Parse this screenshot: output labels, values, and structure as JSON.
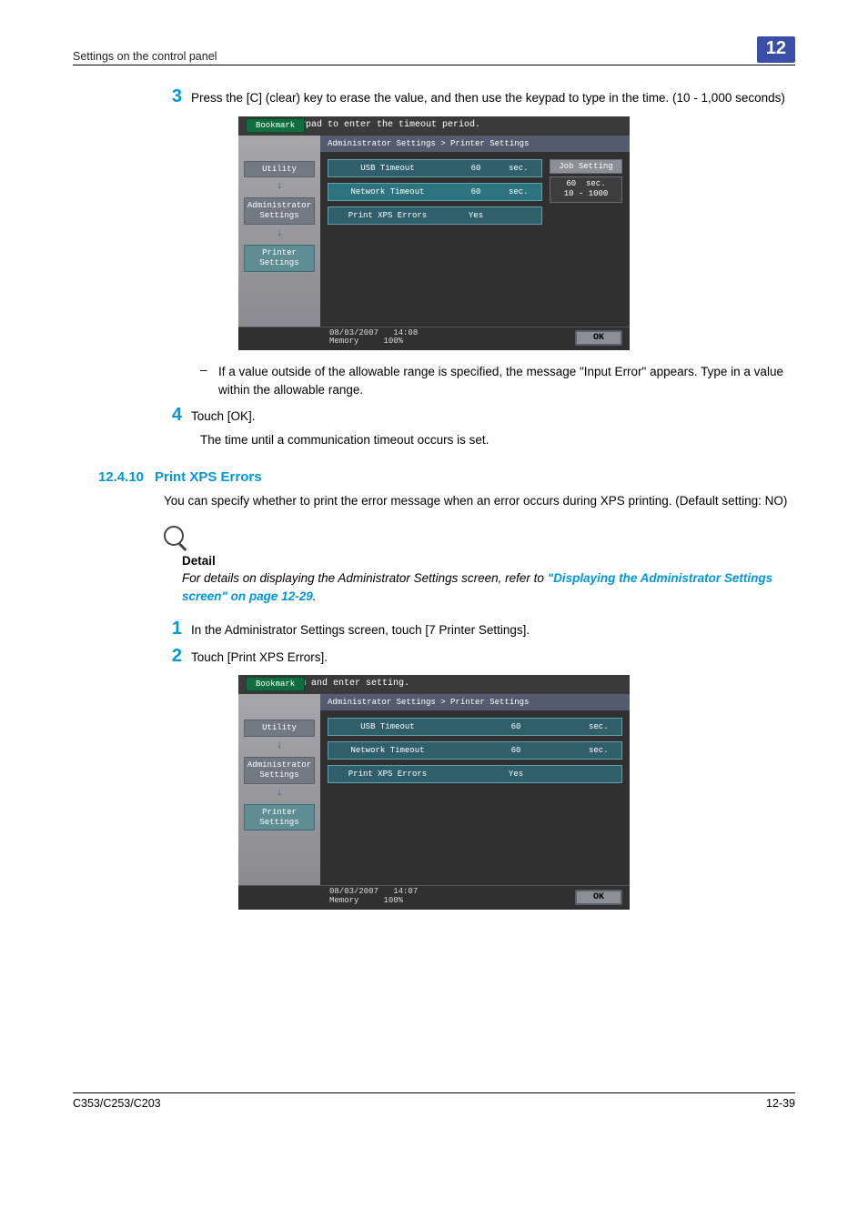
{
  "header": {
    "left": "Settings on the control panel",
    "chapter": "12"
  },
  "step3": {
    "num": "3",
    "text": "Press the [C] (clear) key to erase the value, and then use the keypad to type in the time. (10 - 1,000 seconds)"
  },
  "fig1": {
    "topline": "Use the keypad to enter the timeout period.",
    "bookmark": "Bookmark",
    "side": {
      "utility": "Utility",
      "admin": "Administrator\nSettings",
      "printer": "Printer Settings"
    },
    "crumb": "Administrator Settings > Printer Settings",
    "rows": {
      "usb": {
        "label": "USB Timeout",
        "val": "60",
        "unit": "sec."
      },
      "net": {
        "label": "Network Timeout",
        "val": "60",
        "unit": "sec."
      },
      "xps": {
        "label": "Print XPS Errors",
        "val": "Yes",
        "unit": ""
      }
    },
    "job": {
      "head": "Job Setting",
      "val": "60",
      "unit": "sec.",
      "range": "10  -  1000"
    },
    "status": {
      "date": "08/03/2007",
      "time": "14:08",
      "memlabel": "Memory",
      "mem": "100%"
    },
    "ok": "OK"
  },
  "dash1": "If a value outside of the allowable range is specified, the message \"Input Error\" appears. Type in a value within the allowable range.",
  "step4": {
    "num": "4",
    "text": "Touch [OK]."
  },
  "step4b": "The time until a communication timeout occurs is set.",
  "section": {
    "num": "12.4.10",
    "title": "Print XPS Errors"
  },
  "sectext": "You can specify whether to print the error message when an error occurs during XPS printing. (Default setting: NO)",
  "detail": {
    "label": "Detail",
    "t1": "For details on displaying the Administrator Settings screen, refer to ",
    "link": "\"Displaying the Administrator Settings screen\" on page 12-29",
    "t2": "."
  },
  "step1": {
    "num": "1",
    "text": "In the Administrator Settings screen, touch [7 Printer Settings]."
  },
  "step2": {
    "num": "2",
    "text": "Touch [Print XPS Errors]."
  },
  "fig2": {
    "topline": "Select item and enter setting.",
    "bookmark": "Bookmark",
    "side": {
      "utility": "Utility",
      "admin": "Administrator\nSettings",
      "printer": "Printer Settings"
    },
    "crumb": "Administrator Settings > Printer Settings",
    "rows": {
      "usb": {
        "label": "USB Timeout",
        "val": "60",
        "unit": "sec."
      },
      "net": {
        "label": "Network Timeout",
        "val": "60",
        "unit": "sec."
      },
      "xps": {
        "label": "Print XPS Errors",
        "val": "Yes",
        "unit": ""
      }
    },
    "status": {
      "date": "08/03/2007",
      "time": "14:07",
      "memlabel": "Memory",
      "mem": "100%"
    },
    "ok": "OK"
  },
  "footer": {
    "left": "C353/C253/C203",
    "right": "12-39"
  }
}
